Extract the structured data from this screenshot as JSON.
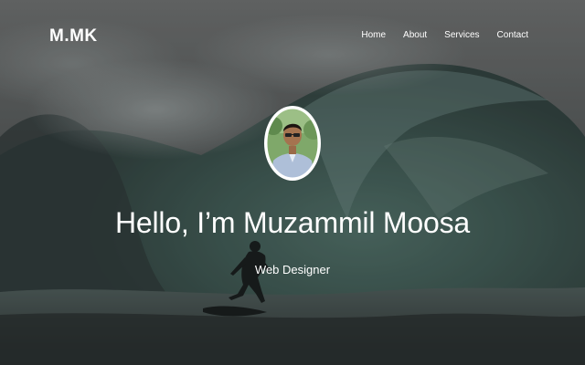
{
  "brand": {
    "logo_text": "M.MK"
  },
  "nav": {
    "items": [
      {
        "label": "Home"
      },
      {
        "label": "About"
      },
      {
        "label": "Services"
      },
      {
        "label": "Contact"
      }
    ]
  },
  "hero": {
    "headline": "Hello, I’m Muzammil Moosa",
    "subtitle": "Web Designer",
    "background": "surfer-wave-photo",
    "overlay_color": "#2f3535"
  },
  "profile": {
    "avatar": "profile-photo"
  }
}
